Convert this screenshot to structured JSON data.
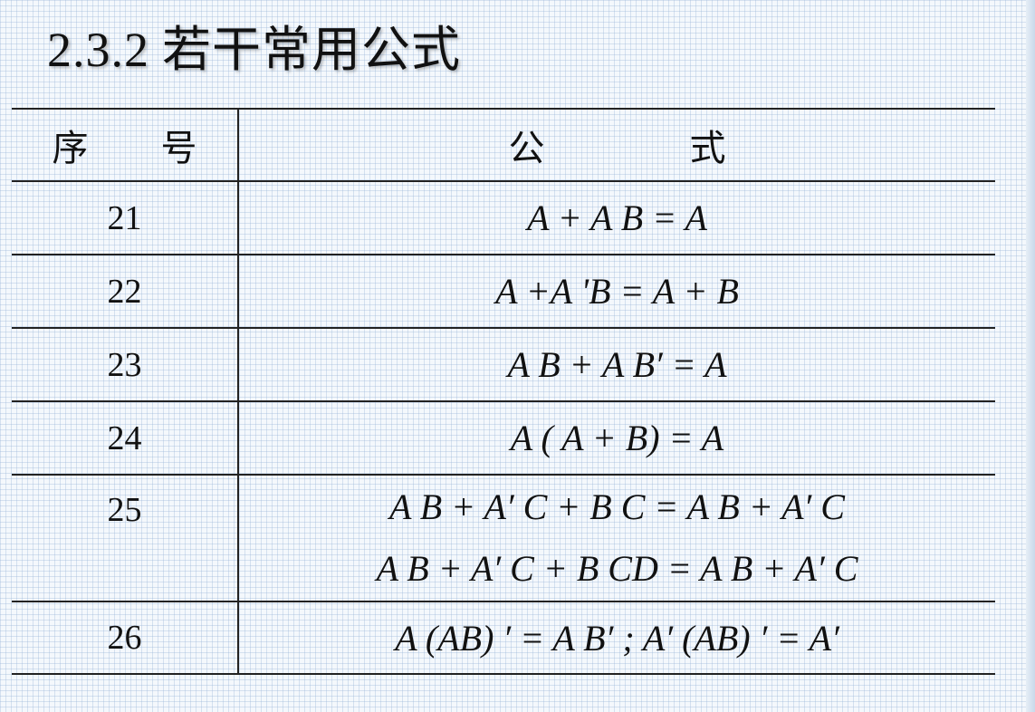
{
  "title": {
    "number": "2.3.2",
    "text": "若干常用公式"
  },
  "table": {
    "headers": {
      "index": "序　　号",
      "formula": "公　　　　式"
    },
    "rows": [
      {
        "index": "21",
        "formulas": [
          "A + A B = A"
        ]
      },
      {
        "index": "22",
        "formulas": [
          "A +A 'B = A + B"
        ]
      },
      {
        "index": "23",
        "formulas": [
          "A B + A B′ = A"
        ]
      },
      {
        "index": "24",
        "formulas": [
          "A ( A + B) = A"
        ]
      },
      {
        "index": "25",
        "formulas": [
          "A B + A′ C + B C = A B + A′ C",
          "A B + A′ C + B CD = A B + A′ C"
        ]
      },
      {
        "index": "26",
        "formulas": [
          "A (AB) ′ = A B′ ; A′ (AB) ′ = A′"
        ]
      }
    ]
  }
}
